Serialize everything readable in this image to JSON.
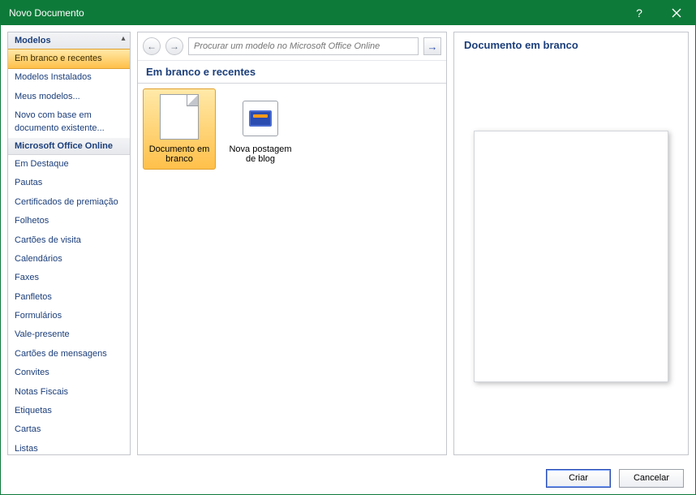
{
  "title": "Novo Documento",
  "sidebar": {
    "header_templates": "Modelos",
    "header_online": "Microsoft Office Online",
    "items_top": [
      "Em branco e recentes",
      "Modelos Instalados",
      "Meus modelos...",
      "Novo com base em documento existente..."
    ],
    "items_bottom": [
      "Em Destaque",
      "Pautas",
      "Certificados de premiação",
      "Folhetos",
      "Cartões de visita",
      "Calendários",
      "Faxes",
      "Panfletos",
      "Formulários",
      "Vale-presente",
      "Cartões de mensagens",
      "Convites",
      "Notas Fiscais",
      "Etiquetas",
      "Cartas",
      "Listas"
    ],
    "selected": "Em branco e recentes"
  },
  "center": {
    "search_placeholder": "Procurar um modelo no Microsoft Office Online",
    "section_title": "Em branco e recentes",
    "items": [
      {
        "label": "Documento em branco",
        "selected": true
      },
      {
        "label": "Nova postagem de blog",
        "selected": false
      }
    ]
  },
  "preview": {
    "title": "Documento em branco"
  },
  "footer": {
    "create": "Criar",
    "cancel": "Cancelar"
  }
}
